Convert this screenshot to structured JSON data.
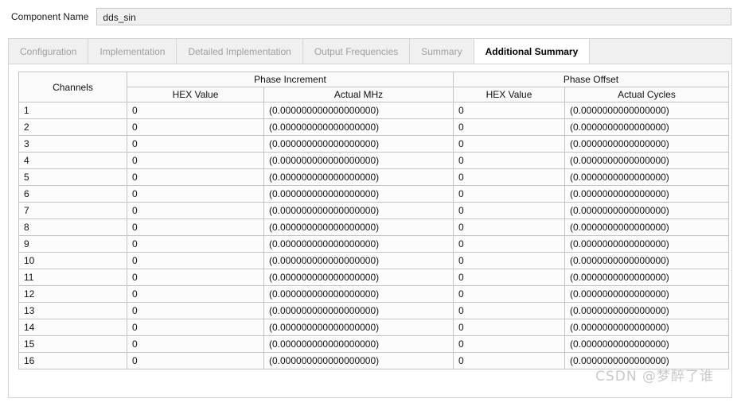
{
  "component": {
    "label": "Component Name",
    "value": "dds_sin"
  },
  "tabs": [
    {
      "label": "Configuration",
      "selected": false
    },
    {
      "label": "Implementation",
      "selected": false
    },
    {
      "label": "Detailed Implementation",
      "selected": false
    },
    {
      "label": "Output Frequencies",
      "selected": false
    },
    {
      "label": "Summary",
      "selected": false
    },
    {
      "label": "Additional Summary",
      "selected": true
    }
  ],
  "table": {
    "channels_header": "Channels",
    "group_headers": [
      "Phase Increment",
      "Phase Offset"
    ],
    "sub_headers": [
      "HEX Value",
      "Actual MHz",
      "HEX Value",
      "Actual Cycles"
    ],
    "rows": [
      {
        "channel": "1",
        "pi_hex": "0",
        "pi_mhz": "(0.000000000000000000)",
        "po_hex": "0",
        "po_cycles": "(0.0000000000000000)"
      },
      {
        "channel": "2",
        "pi_hex": "0",
        "pi_mhz": "(0.000000000000000000)",
        "po_hex": "0",
        "po_cycles": "(0.0000000000000000)"
      },
      {
        "channel": "3",
        "pi_hex": "0",
        "pi_mhz": "(0.000000000000000000)",
        "po_hex": "0",
        "po_cycles": "(0.0000000000000000)"
      },
      {
        "channel": "4",
        "pi_hex": "0",
        "pi_mhz": "(0.000000000000000000)",
        "po_hex": "0",
        "po_cycles": "(0.0000000000000000)"
      },
      {
        "channel": "5",
        "pi_hex": "0",
        "pi_mhz": "(0.000000000000000000)",
        "po_hex": "0",
        "po_cycles": "(0.0000000000000000)"
      },
      {
        "channel": "6",
        "pi_hex": "0",
        "pi_mhz": "(0.000000000000000000)",
        "po_hex": "0",
        "po_cycles": "(0.0000000000000000)"
      },
      {
        "channel": "7",
        "pi_hex": "0",
        "pi_mhz": "(0.000000000000000000)",
        "po_hex": "0",
        "po_cycles": "(0.0000000000000000)"
      },
      {
        "channel": "8",
        "pi_hex": "0",
        "pi_mhz": "(0.000000000000000000)",
        "po_hex": "0",
        "po_cycles": "(0.0000000000000000)"
      },
      {
        "channel": "9",
        "pi_hex": "0",
        "pi_mhz": "(0.000000000000000000)",
        "po_hex": "0",
        "po_cycles": "(0.0000000000000000)"
      },
      {
        "channel": "10",
        "pi_hex": "0",
        "pi_mhz": "(0.000000000000000000)",
        "po_hex": "0",
        "po_cycles": "(0.0000000000000000)"
      },
      {
        "channel": "11",
        "pi_hex": "0",
        "pi_mhz": "(0.000000000000000000)",
        "po_hex": "0",
        "po_cycles": "(0.0000000000000000)"
      },
      {
        "channel": "12",
        "pi_hex": "0",
        "pi_mhz": "(0.000000000000000000)",
        "po_hex": "0",
        "po_cycles": "(0.0000000000000000)"
      },
      {
        "channel": "13",
        "pi_hex": "0",
        "pi_mhz": "(0.000000000000000000)",
        "po_hex": "0",
        "po_cycles": "(0.0000000000000000)"
      },
      {
        "channel": "14",
        "pi_hex": "0",
        "pi_mhz": "(0.000000000000000000)",
        "po_hex": "0",
        "po_cycles": "(0.0000000000000000)"
      },
      {
        "channel": "15",
        "pi_hex": "0",
        "pi_mhz": "(0.000000000000000000)",
        "po_hex": "0",
        "po_cycles": "(0.0000000000000000)"
      },
      {
        "channel": "16",
        "pi_hex": "0",
        "pi_mhz": "(0.000000000000000000)",
        "po_hex": "0",
        "po_cycles": "(0.0000000000000000)"
      }
    ]
  },
  "watermark": {
    "text": "CSDN @梦醉了谁"
  },
  "colors": {
    "tab_bar_bg": "#f0f0f0",
    "selected_tab_bg": "#ffffff",
    "inactive_tab_text": "#a0a0a0",
    "border": "#c4c4c4",
    "field_bg": "#f0f0f0",
    "watermark": "#c9c9c9"
  }
}
